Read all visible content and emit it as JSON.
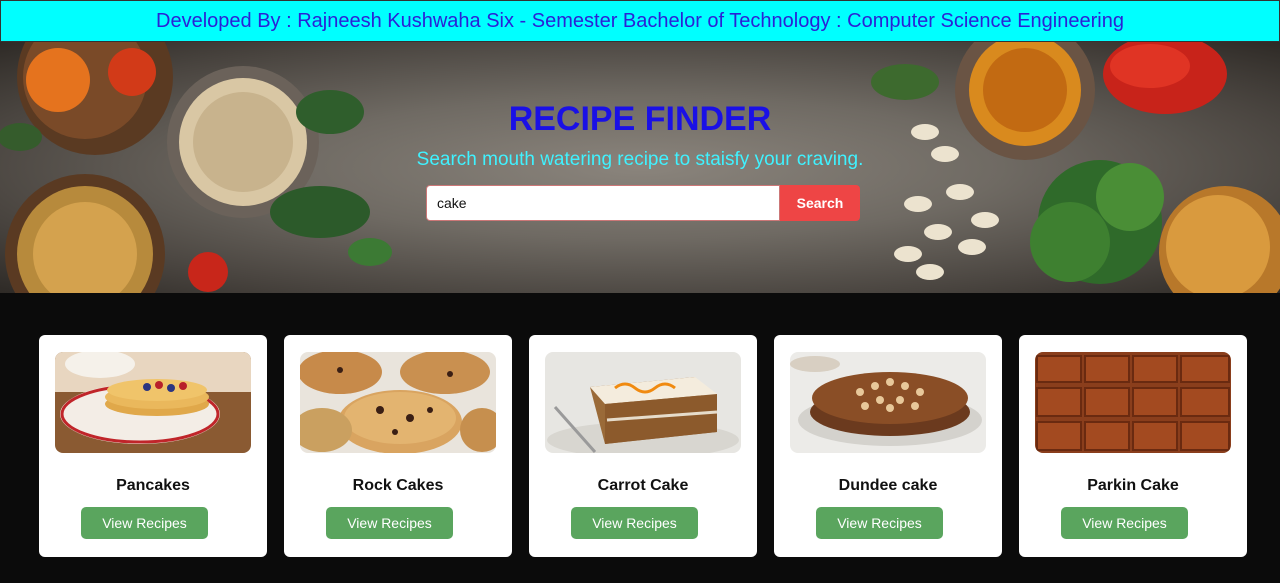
{
  "banner": {
    "text": "Developed By : Rajneesh Kushwaha Six - Semester Bachelor of Technology : Computer Science Engineering"
  },
  "hero": {
    "title": "RECIPE FINDER",
    "subtitle": "Search mouth watering recipe to staisfy your craving.",
    "search": {
      "value": "cake",
      "button_label": "Search"
    }
  },
  "recipes": [
    {
      "name": "Pancakes",
      "button_label": "View Recipes"
    },
    {
      "name": "Rock Cakes",
      "button_label": "View Recipes"
    },
    {
      "name": "Carrot Cake",
      "button_label": "View Recipes"
    },
    {
      "name": "Dundee cake",
      "button_label": "View Recipes"
    },
    {
      "name": "Parkin Cake",
      "button_label": "View Recipes"
    }
  ],
  "colors": {
    "banner_bg": "#00ffff",
    "banner_text": "#2b22d6",
    "title": "#1a10e6",
    "subtitle": "#3ff2ff",
    "search_button": "#ee4545",
    "view_button": "#5aa55e",
    "results_bg": "#0b0b0b"
  }
}
